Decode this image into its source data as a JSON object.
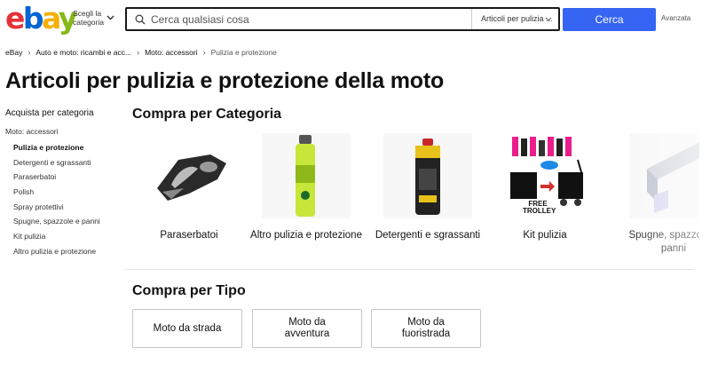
{
  "header": {
    "logo": {
      "l1": "e",
      "l2": "b",
      "l3": "a",
      "l4": "y"
    },
    "category_selector": {
      "label": "Scegli la categoria"
    },
    "search": {
      "placeholder": "Cerca qualsiasi cosa",
      "scope": "Articoli per pulizia ..."
    },
    "search_button": "Cerca",
    "advanced_link": "Avanzata"
  },
  "breadcrumb": [
    "eBay",
    "Auto e moto: ricambi e acc...",
    "Moto: accessori",
    "Pulizia e protezione"
  ],
  "page_title": "Articoli per pulizia e protezione della moto",
  "sidebar": {
    "heading": "Acquista per categoria",
    "parent": "Moto: accessori",
    "items": [
      {
        "label": "Pulizia e protezione",
        "active": true
      },
      {
        "label": "Detergenti e sgrassanti"
      },
      {
        "label": "Paraserbatoi"
      },
      {
        "label": "Polish"
      },
      {
        "label": "Spray protettivi"
      },
      {
        "label": "Spugne, spazzole e panni"
      },
      {
        "label": "Kit pulizia"
      },
      {
        "label": "Altro pulizia e protezione"
      }
    ]
  },
  "shop_by_category": {
    "title": "Compra per Categoria",
    "items": [
      {
        "label": "Paraserbatoi",
        "icon": "tank-pad-image"
      },
      {
        "label": "Altro pulizia e protezione",
        "icon": "spray-can-image"
      },
      {
        "label": "Detergenti e sgrassanti",
        "icon": "degreaser-can-image"
      },
      {
        "label": "Kit pulizia",
        "icon": "cleaning-kit-image",
        "image_text": "FREE TROLLEY"
      },
      {
        "label": "Spugne, spazzole e panni",
        "icon": "sponge-image"
      }
    ]
  },
  "shop_by_type": {
    "title": "Compra per Tipo",
    "items": [
      "Moto da strada",
      "Moto da avventura",
      "Moto da fuoristrada"
    ]
  },
  "colors": {
    "search_button": "#3665f3",
    "ebay_red": "#e53238",
    "ebay_blue": "#0064d2",
    "ebay_yellow": "#f5af02",
    "ebay_green": "#86b817"
  }
}
